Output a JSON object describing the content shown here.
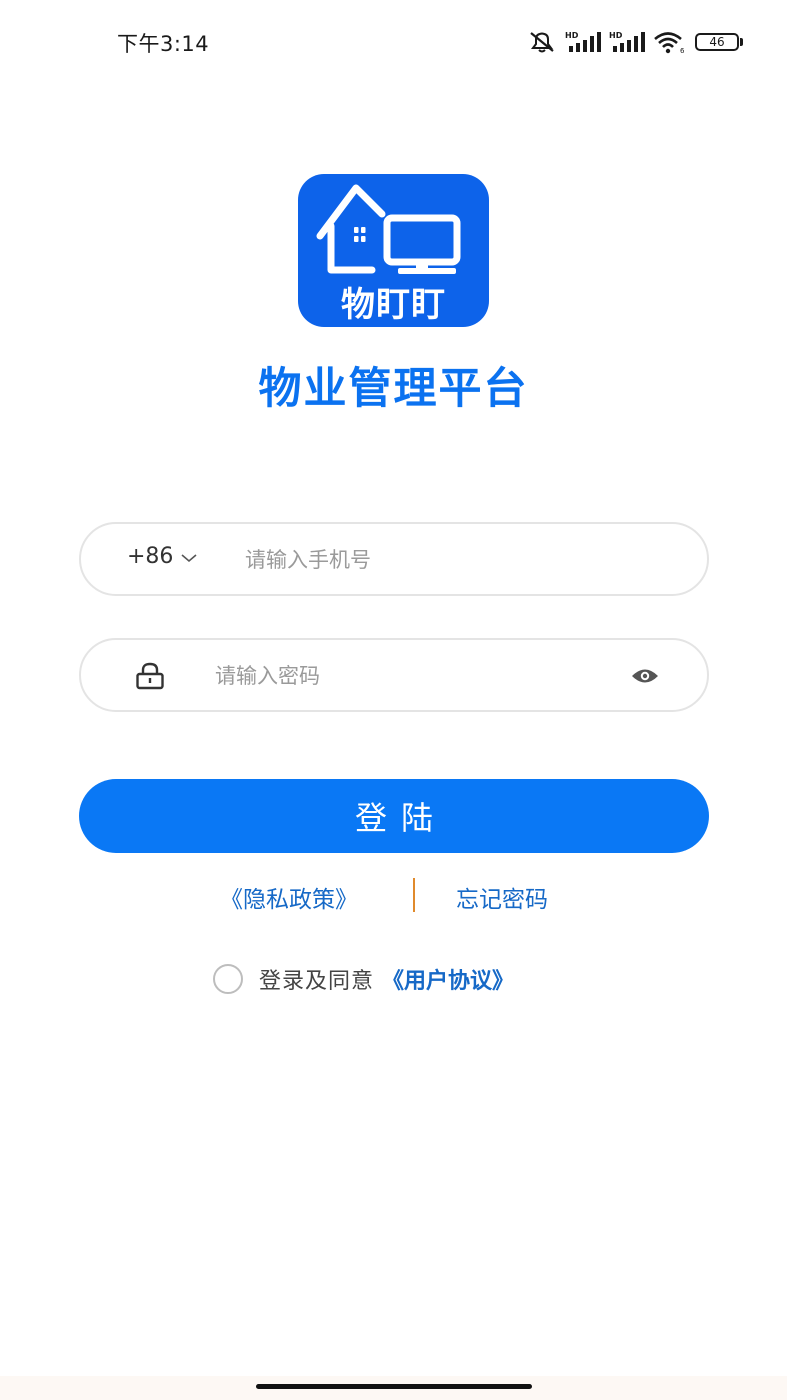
{
  "status_bar": {
    "time": "下午3:14",
    "battery": "46",
    "icons": [
      "mute-icon",
      "signal-hd-icon",
      "signal-hd-icon",
      "wifi-icon",
      "battery-icon"
    ]
  },
  "logo": {
    "text": "物盯盯",
    "background_color": "#0d63ea"
  },
  "app_title": "物业管理平台",
  "phone_field": {
    "country_code": "+86",
    "placeholder": "请输入手机号",
    "value": ""
  },
  "password_field": {
    "placeholder": "请输入密码",
    "value": ""
  },
  "login_button": {
    "label": "登陆",
    "color": "#0a78f5"
  },
  "links": {
    "privacy_policy": "《隐私政策》",
    "forgot_password": "忘记密码"
  },
  "agreement": {
    "text": "登录及同意",
    "link": "《用户协议》",
    "checked": false
  },
  "colors": {
    "accent": "#0b72f0",
    "link": "#1669c7",
    "divider": "#e08a2c"
  }
}
